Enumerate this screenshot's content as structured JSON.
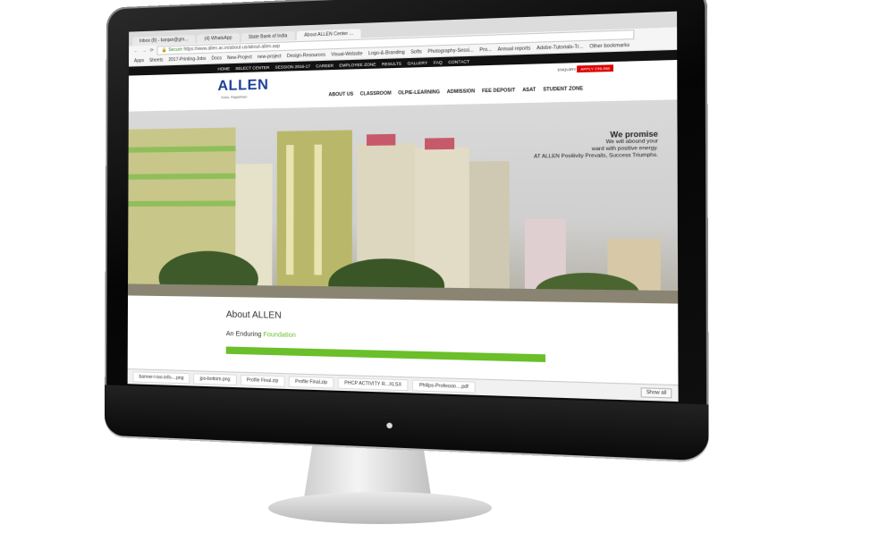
{
  "browser": {
    "tabs": [
      "Inbox (8) - kanjan@gm...",
      "(4) WhatsApp",
      "State Bank of India",
      "About ALLEN Center ..."
    ],
    "url_secure": "Secure",
    "url": "https://www.allen.ac.in/about-us/about-allen.asp",
    "bookmarks": [
      "Apps",
      "Sheets",
      "2017-Printing-Jobs",
      "Docs",
      "New-Project",
      "new-project",
      "Design-Resources",
      "Visual-Website",
      "Logo-&-Branding",
      "Softs",
      "Photography-Sessi...",
      "Pro...",
      "Annual reports",
      "Adobe-Tutorials-Tr...",
      "Other bookmarks"
    ]
  },
  "site": {
    "topbar": [
      "HOME",
      "SELECT CENTER",
      "SESSION 2016-17",
      "CAREER",
      "EMPLOYEE ZONE",
      "RESULTS",
      "GALLERY",
      "FAQ",
      "CONTACT"
    ],
    "logo": "ALLEN",
    "logo_sub": "Kota, Rajasthan",
    "enquiry": "ENQUIRY",
    "apply": "APPLY ONLINE",
    "nav": [
      "ABOUT US",
      "CLASSROOM",
      "OLPIE-LEARNING",
      "ADMISSION",
      "FEE DEPOSIT",
      "ASAT",
      "STUDENT ZONE"
    ],
    "banner_title": "We promise",
    "banner_line1": "We will abound your",
    "banner_line2": "ward with positive energy.",
    "banner_line3": "AT ALLEN Positivity Prevails, Success Triumphs.",
    "about_title": "About ALLEN",
    "subtitle_prefix": "An Enduring",
    "subtitle_highlight": "Foundation"
  },
  "downloads": {
    "items": [
      "banner-l-iso-info-...png",
      "jpo-bottom.png",
      "Profile Final.zip",
      "Profile Final.zip",
      "PHCP ACTIVITY R...XLSX",
      "Philips-Professio....pdf"
    ],
    "show_all": "Show all"
  },
  "colors": {
    "brand_blue": "#1e3f9a",
    "accent_green": "#6bbf2a",
    "apply_red": "#dd0000"
  }
}
